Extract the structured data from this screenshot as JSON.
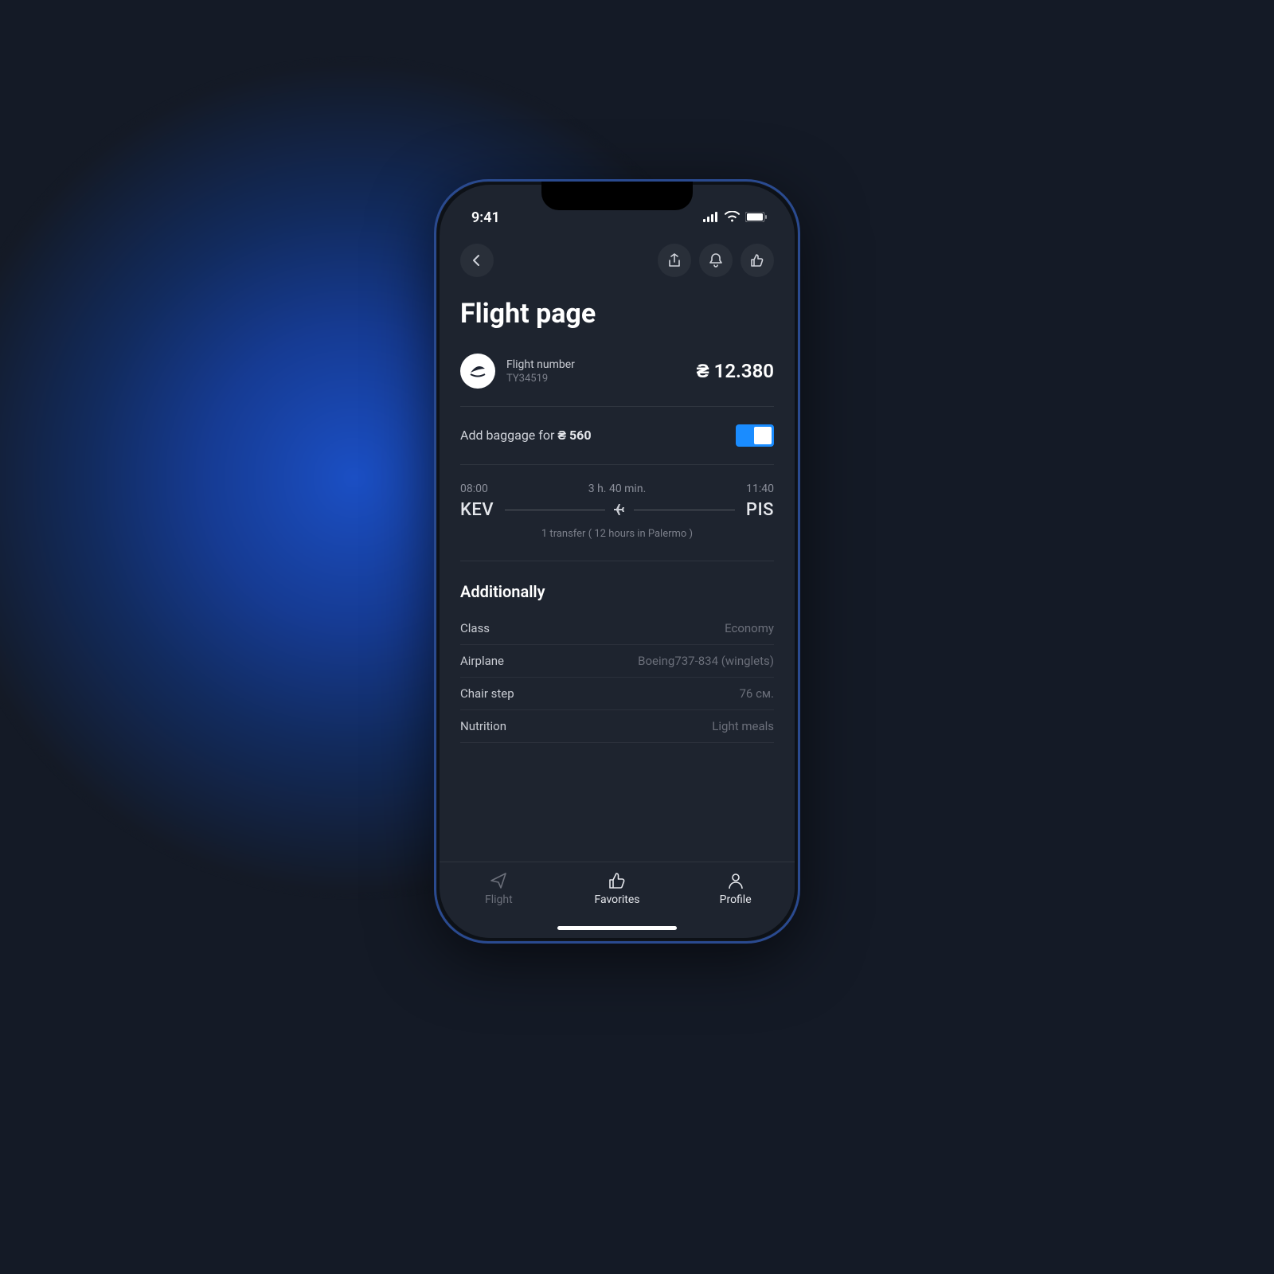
{
  "status": {
    "time": "9:41"
  },
  "page": {
    "title": "Flight page"
  },
  "flight": {
    "fn_label": "Flight number",
    "fn_value": "TY34519",
    "price": "₴ 12.380"
  },
  "baggage": {
    "prefix": "Add baggage for ",
    "price": "₴ 560"
  },
  "route": {
    "dep_time": "08:00",
    "duration": "3 h. 40 min.",
    "arr_time": "11:40",
    "dep_code": "KEV",
    "arr_code": "PIS",
    "transfer": "1 transfer ( 12 hours in Palermo )"
  },
  "additionally": {
    "title": "Additionally",
    "rows": [
      {
        "label": "Class",
        "value": "Economy"
      },
      {
        "label": "Airplane",
        "value": "Boeing737-834 (winglets)"
      },
      {
        "label": "Chair step",
        "value": "76 см."
      },
      {
        "label": "Nutrition",
        "value": "Light meals"
      }
    ]
  },
  "tabs": {
    "flight": "Flight",
    "favorites": "Favorites",
    "profile": "Profile"
  }
}
